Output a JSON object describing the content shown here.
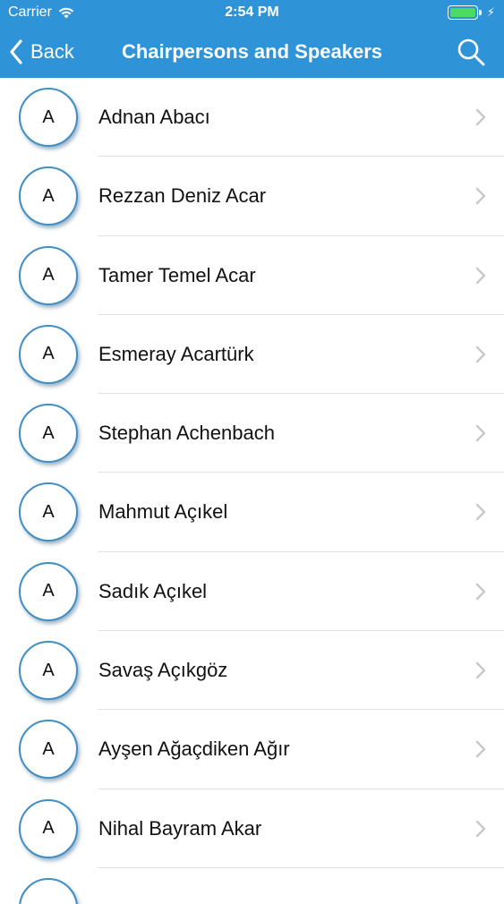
{
  "status_bar": {
    "carrier": "Carrier",
    "time": "2:54 PM",
    "battery_level": 1.0
  },
  "nav": {
    "back_label": "Back",
    "title": "Chairpersons and Speakers",
    "back_icon": "chevron-left-icon",
    "search_icon": "search-icon"
  },
  "colors": {
    "header_bg": "#2f93d8",
    "avatar_border": "#3f8fc6",
    "battery_fill": "#4cd964"
  },
  "speakers": [
    {
      "initial": "A",
      "name": "Adnan Abacı"
    },
    {
      "initial": "A",
      "name": "Rezzan Deniz Acar"
    },
    {
      "initial": "A",
      "name": "Tamer Temel Acar"
    },
    {
      "initial": "A",
      "name": "Esmeray Acartürk"
    },
    {
      "initial": "A",
      "name": "Stephan Achenbach"
    },
    {
      "initial": "A",
      "name": "Mahmut Açıkel"
    },
    {
      "initial": "A",
      "name": "Sadık Açıkel"
    },
    {
      "initial": "A",
      "name": "Savaş Açıkgöz"
    },
    {
      "initial": "A",
      "name": "Ayşen Ağaçdiken Ağır"
    },
    {
      "initial": "A",
      "name": "Nihal Bayram Akar"
    }
  ]
}
